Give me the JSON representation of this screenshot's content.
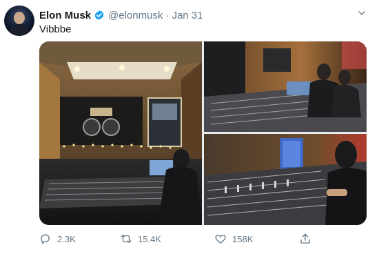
{
  "tweet": {
    "author_name": "Elon Musk",
    "handle": "@elonmusk",
    "separator": "·",
    "date": "Jan 31",
    "text": "Vibbbe",
    "verified_color": "#1da1f2"
  },
  "media": {
    "photos": [
      {
        "subject": "studio-control-room-wide"
      },
      {
        "subject": "studio-mixing-console-engineers"
      },
      {
        "subject": "studio-mixing-console-closeup"
      }
    ]
  },
  "actions": {
    "reply_count": "2.3K",
    "retweet_count": "15.4K",
    "like_count": "158K",
    "icons": [
      "reply-icon",
      "retweet-icon",
      "like-icon",
      "share-icon"
    ]
  },
  "colors": {
    "text_primary": "#14171a",
    "text_secondary": "#657786",
    "accent": "#1da1f2"
  }
}
